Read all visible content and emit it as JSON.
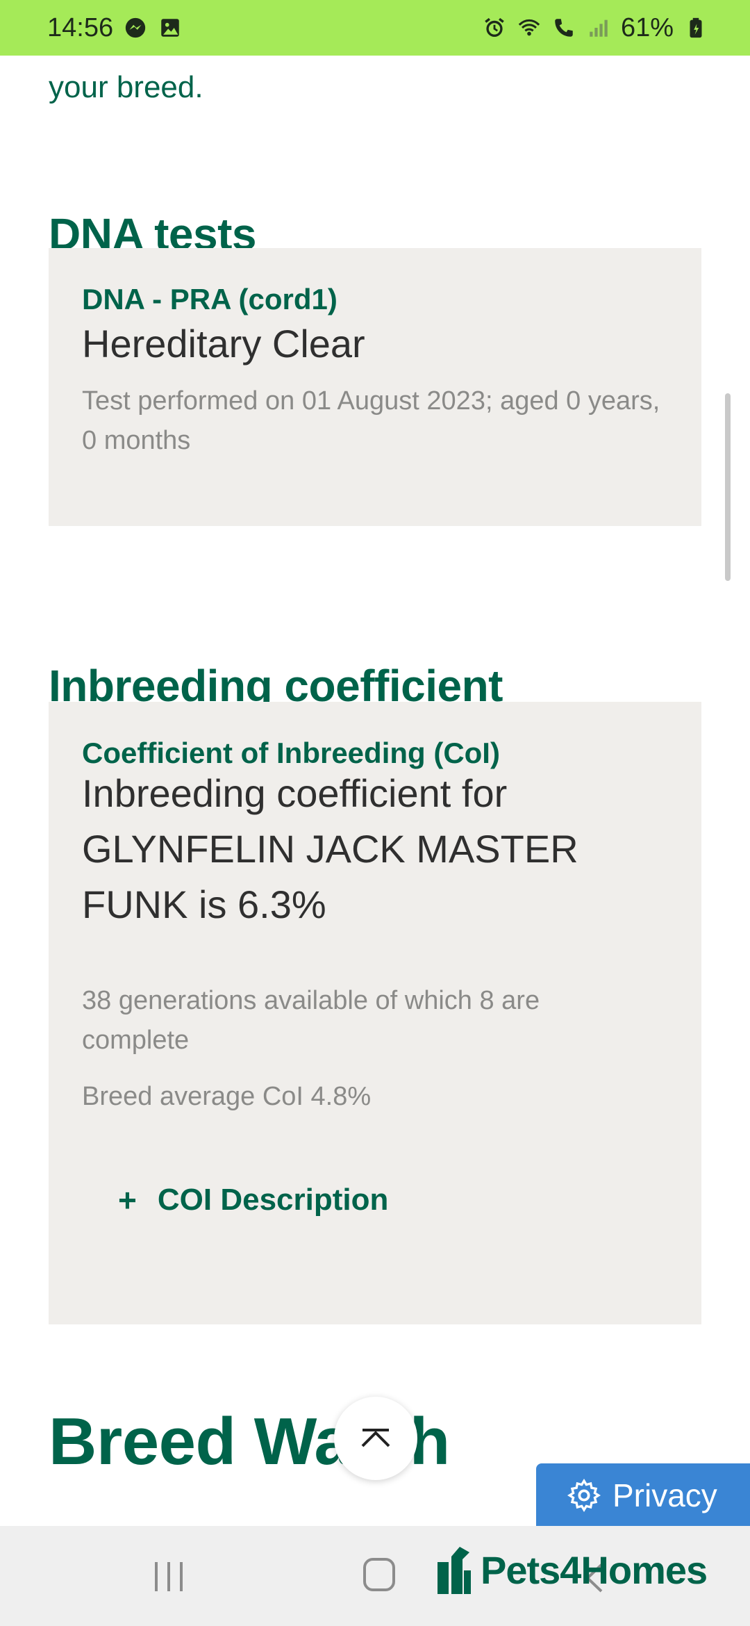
{
  "status_bar": {
    "time": "14:56",
    "battery": "61%",
    "left_icons": [
      "messenger-icon",
      "gallery-icon"
    ],
    "right_icons": [
      "alarm-icon",
      "wifi-icon",
      "wifi-call-icon",
      "signal-icon",
      "battery-icon"
    ]
  },
  "intro_tail": "your breed.",
  "dna_section": {
    "title": "DNA tests",
    "label": "DNA - PRA (cord1)",
    "value": "Hereditary Clear",
    "note": "Test performed on 01 August 2023; aged 0 years, 0 months"
  },
  "inbreeding_section": {
    "title": "Inbreeding coefficient",
    "label": "Coefficient of Inbreeding (CoI)",
    "value": "Inbreeding coefficient for GLYNFELIN JACK MASTER FUNK is 6.3%",
    "generations": "38 generations available of which 8 are complete",
    "breed_average": "Breed average CoI 4.8%",
    "toggle_symbol": "+",
    "toggle_label": "COI Description"
  },
  "breed_section": {
    "title": "Breed Watch"
  },
  "privacy_label": "Privacy",
  "brand_name": "Pets4Homes"
}
